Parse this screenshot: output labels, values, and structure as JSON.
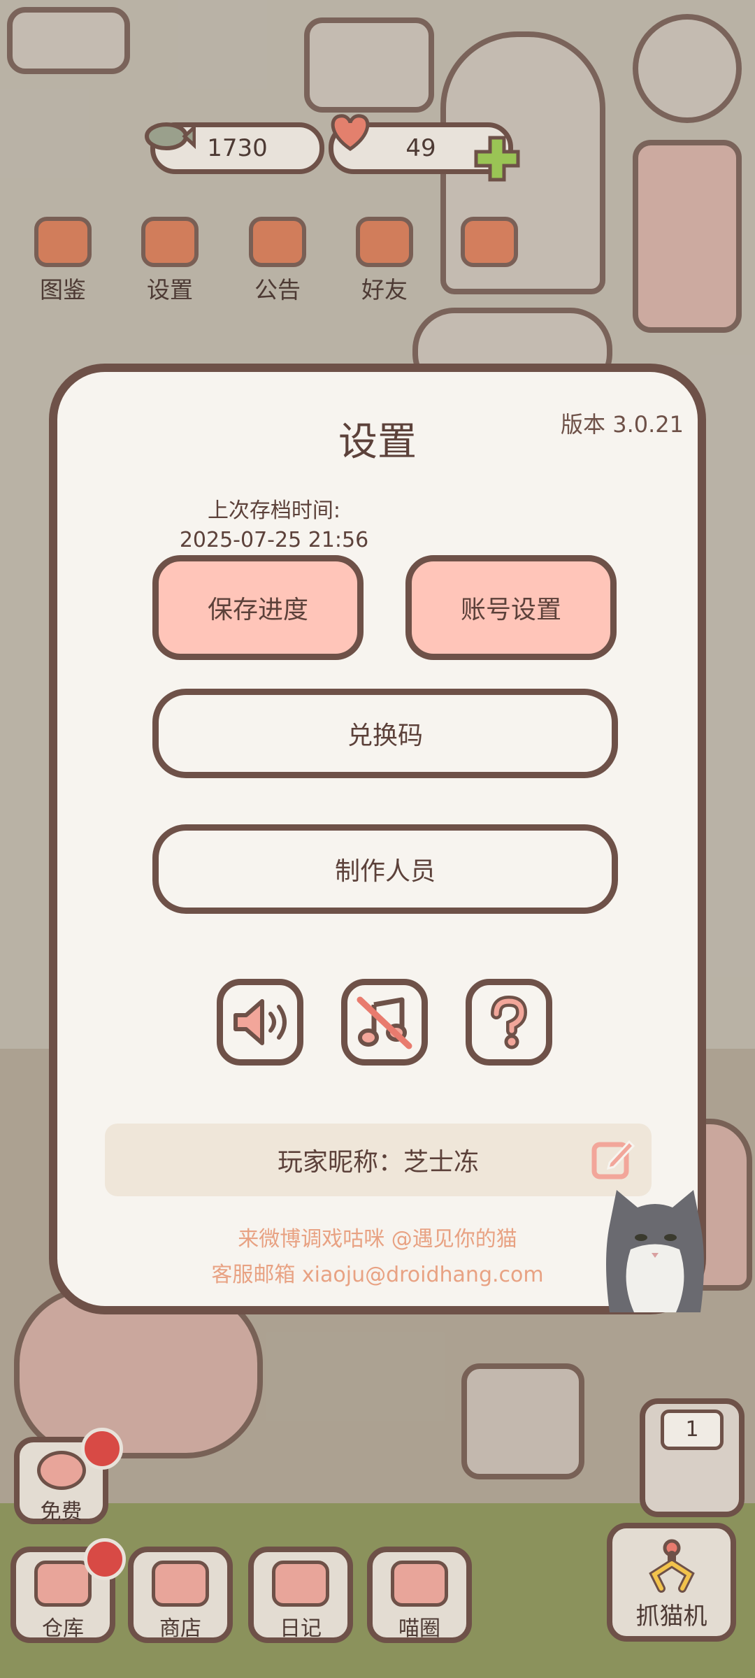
{
  "hud": {
    "fish_count": "1730",
    "heart_count": "49",
    "menu": [
      {
        "label": "图鉴",
        "icon": "cat-book-icon"
      },
      {
        "label": "设置",
        "icon": "gear-icon"
      },
      {
        "label": "公告",
        "icon": "gift-icon"
      },
      {
        "label": "好友",
        "icon": "friends-icon"
      }
    ]
  },
  "dialog": {
    "title": "设置",
    "version": "版本 3.0.21",
    "last_save_label": "上次存档时间:",
    "last_save_time": "2025-07-25 21:56",
    "save_button": "保存进度",
    "account_button": "账号设置",
    "redeem_button": "兑换码",
    "credits_button": "制作人员",
    "icon_buttons": [
      "sound-icon",
      "music-off-icon",
      "help-icon"
    ],
    "nickname": "玩家昵称：芝士冻",
    "footer_weibo": "来微博调戏咕咪 @遇见你的猫",
    "footer_email": "客服邮箱 xiaoju@droidhang.com"
  },
  "bottom": {
    "free_label": "免费",
    "claw_counter": "1",
    "claw_label": "抓猫机",
    "nav": [
      {
        "label": "仓库",
        "icon": "storage-icon"
      },
      {
        "label": "商店",
        "icon": "shop-icon"
      },
      {
        "label": "日记",
        "icon": "diary-icon"
      },
      {
        "label": "喵圈",
        "icon": "cat-planet-icon"
      }
    ]
  },
  "colors": {
    "outline": "#6e5148",
    "dialog_bg": "#f7f4ef",
    "pink_button": "#ffc5b9",
    "footer_text": "#e8a283",
    "badge": "#d84a45"
  }
}
